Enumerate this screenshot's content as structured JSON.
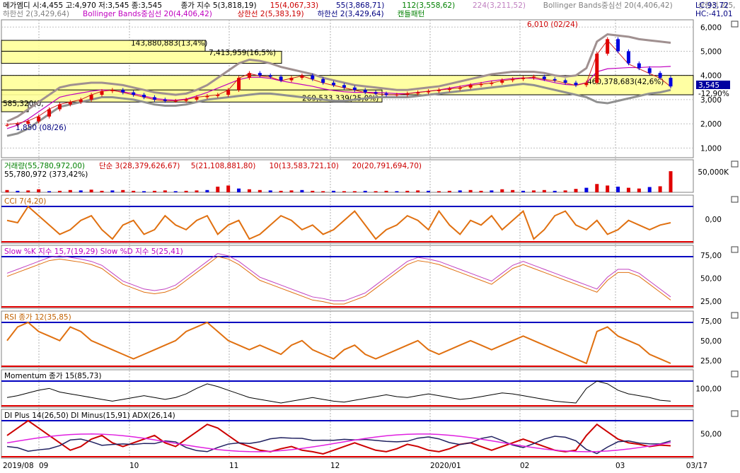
{
  "header": {
    "line1": [
      {
        "text": "메가엠디 시:4,455 고:4,970 저:3,545 종:3,545",
        "color": "#000000"
      },
      {
        "text": "종가 지수 5(3,818,19)",
        "color": "#000000"
      },
      {
        "text": "15(4,067,33)",
        "color": "#cc0000"
      },
      {
        "text": "55(3,868,71)",
        "color": "#000080"
      },
      {
        "text": "112(3,558,62)",
        "color": "#008000"
      },
      {
        "text": "224(3,211,52)",
        "color": "#c080c0"
      },
      {
        "text": "Bollinger Bands중심선 20(4,406,42)",
        "color": "#808080"
      },
      {
        "text": "상한선 2(5,",
        "color": "#808080"
      }
    ],
    "line2": [
      {
        "text": "하한선 2(3,429,64)",
        "color": "#808080"
      },
      {
        "text": "Bollinger Bands중심선 20(4,406,42)",
        "color": "#c000c0"
      },
      {
        "text": "상한선 2(5,383,19)",
        "color": "#cc0000"
      },
      {
        "text": "하한선 2(3,429,64)",
        "color": "#000080"
      },
      {
        "text": "캔들패턴",
        "color": "#008000"
      }
    ],
    "lc": "LC:93,72",
    "hc": "HC:-41,01",
    "icon": "blue-square-marker"
  },
  "price_panel": {
    "annotations": {
      "high_label": "6,010 (02/24)",
      "low_label": "1,850 (08/26)",
      "box_labels": [
        "143,880,883(13,4%)",
        "7,413,959(16,5%)",
        "269,533,339(25,0%)",
        "460,378,683(42,6%)",
        "585,320(0,"
      ],
      "current_price": "3,545",
      "change_pct": "-12,90%"
    },
    "chart_data": {
      "type": "line",
      "ylim": [
        600,
        6300
      ],
      "yticks": [
        "6,000",
        "5,000",
        "4,000",
        "3,000",
        "2,000",
        "1,000"
      ],
      "ytick_values": [
        6000,
        5000,
        4000,
        3000,
        2000,
        1000
      ],
      "close_series": [
        1950,
        2000,
        2100,
        2300,
        2600,
        2800,
        2900,
        3000,
        3200,
        3350,
        3400,
        3300,
        3200,
        3100,
        3000,
        2950,
        2950,
        3000,
        3100,
        3150,
        3200,
        3400,
        3900,
        4100,
        4000,
        3950,
        3800,
        3900,
        4000,
        3850,
        3700,
        3600,
        3500,
        3400,
        3300,
        3250,
        3200,
        3200,
        3250,
        3300,
        3350,
        3400,
        3450,
        3500,
        3600,
        3650,
        3700,
        3800,
        3850,
        3900,
        3950,
        3850,
        3800,
        3700,
        3600,
        3700,
        4900,
        5500,
        5000,
        4500,
        4300,
        4100,
        3900,
        3545
      ],
      "bollinger_upper": [
        2100,
        2300,
        2600,
        2900,
        3200,
        3500,
        3600,
        3650,
        3700,
        3700,
        3650,
        3600,
        3500,
        3400,
        3300,
        3250,
        3200,
        3250,
        3400,
        3600,
        3900,
        4200,
        4500,
        4650,
        4600,
        4500,
        4350,
        4250,
        4150,
        4050,
        3900,
        3800,
        3700,
        3600,
        3550,
        3500,
        3450,
        3400,
        3400,
        3450,
        3500,
        3550,
        3650,
        3750,
        3850,
        3950,
        4050,
        4100,
        4150,
        4150,
        4150,
        4100,
        4000,
        3950,
        4000,
        4300,
        5400,
        5700,
        5650,
        5600,
        5500,
        5450,
        5400,
        5350
      ],
      "bollinger_lower": [
        1500,
        1600,
        1800,
        2100,
        2400,
        2700,
        2800,
        2900,
        3000,
        3100,
        3100,
        3050,
        3000,
        2900,
        2800,
        2750,
        2750,
        2800,
        2900,
        3000,
        3050,
        3100,
        3150,
        3200,
        3250,
        3250,
        3200,
        3150,
        3100,
        3050,
        3000,
        2950,
        2950,
        3000,
        3050,
        3100,
        3100,
        3100,
        3100,
        3150,
        3200,
        3250,
        3300,
        3350,
        3400,
        3450,
        3500,
        3550,
        3600,
        3650,
        3600,
        3500,
        3400,
        3300,
        3200,
        3100,
        2900,
        2850,
        2950,
        3050,
        3150,
        3250,
        3300,
        3400
      ],
      "volume_label": "거래량(55,780,972,00)",
      "volume_ma": [
        "단순 3(28,379,626,67)",
        "5(21,108,881,80)",
        "10(13,583,721,10)",
        "20(20,791,694,70)"
      ],
      "volume_note": "55,780,972 (373,42%)",
      "volume_tick": "50,000K",
      "volume_values": [
        6,
        4,
        5,
        8,
        3,
        4,
        6,
        5,
        7,
        4,
        5,
        6,
        4,
        3,
        4,
        5,
        3,
        4,
        5,
        6,
        15,
        18,
        10,
        8,
        6,
        5,
        4,
        5,
        6,
        4,
        3,
        4,
        3,
        3,
        4,
        3,
        4,
        3,
        4,
        5,
        4,
        3,
        4,
        5,
        6,
        4,
        5,
        8,
        6,
        4,
        5,
        6,
        4,
        5,
        9,
        12,
        22,
        18,
        15,
        12,
        10,
        14,
        16,
        56
      ]
    }
  },
  "indicators": [
    {
      "label": "CCI 7(4,20)",
      "tick": "0,00",
      "values": [
        10,
        5,
        40,
        20,
        0,
        -20,
        -10,
        10,
        20,
        -10,
        -30,
        0,
        10,
        -20,
        -10,
        20,
        0,
        -10,
        10,
        20,
        -20,
        0,
        10,
        -30,
        -20,
        0,
        20,
        10,
        -10,
        0,
        -20,
        -10,
        10,
        30,
        0,
        -30,
        -10,
        0,
        20,
        10,
        -10,
        30,
        0,
        -20,
        10,
        0,
        20,
        -10,
        10,
        30,
        -30,
        -10,
        20,
        30,
        0,
        -10,
        10,
        -20,
        -10,
        10,
        0,
        -10,
        0,
        5
      ]
    },
    {
      "label": "Slow %K 지수 15,7(19,29)  Slow %D 지수 5(25,41)",
      "ticks": [
        "75,00",
        "50,00",
        "25,00"
      ],
      "values": [
        50,
        55,
        60,
        65,
        70,
        72,
        70,
        68,
        65,
        60,
        50,
        40,
        35,
        30,
        28,
        30,
        35,
        45,
        55,
        65,
        75,
        72,
        65,
        55,
        45,
        40,
        35,
        30,
        25,
        20,
        18,
        15,
        15,
        20,
        25,
        35,
        45,
        55,
        65,
        70,
        68,
        65,
        60,
        55,
        50,
        45,
        40,
        50,
        60,
        65,
        60,
        55,
        50,
        45,
        40,
        35,
        30,
        45,
        55,
        55,
        50,
        40,
        30,
        20
      ]
    },
    {
      "label": "RSI 종가 12(35,85)",
      "ticks": [
        "75,00",
        "50,00",
        "25,00"
      ],
      "values": [
        60,
        75,
        80,
        70,
        65,
        60,
        75,
        70,
        60,
        55,
        50,
        45,
        40,
        45,
        50,
        55,
        60,
        70,
        75,
        80,
        70,
        60,
        55,
        50,
        55,
        50,
        45,
        55,
        60,
        50,
        45,
        40,
        50,
        55,
        45,
        40,
        45,
        50,
        55,
        60,
        50,
        45,
        50,
        55,
        60,
        55,
        50,
        55,
        60,
        65,
        60,
        55,
        50,
        45,
        40,
        35,
        70,
        75,
        65,
        60,
        55,
        45,
        40,
        35
      ]
    },
    {
      "label": "Momentum 종가 15(85,73)",
      "tick": "100,00",
      "values": [
        100,
        102,
        105,
        108,
        110,
        106,
        104,
        102,
        100,
        98,
        96,
        98,
        100,
        102,
        100,
        98,
        100,
        104,
        110,
        115,
        112,
        108,
        104,
        100,
        98,
        96,
        94,
        96,
        98,
        100,
        98,
        96,
        95,
        97,
        99,
        101,
        103,
        101,
        100,
        102,
        104,
        102,
        100,
        98,
        99,
        101,
        103,
        105,
        104,
        102,
        100,
        98,
        96,
        95,
        94,
        110,
        118,
        115,
        108,
        104,
        102,
        100,
        97,
        96
      ]
    },
    {
      "label": "DI Plus 14(26,50)  DI Minus(15,91)  ADX(26,14)",
      "tick": "50,00",
      "values": [
        40,
        50,
        60,
        50,
        40,
        30,
        20,
        25,
        35,
        40,
        30,
        25,
        30,
        35,
        40,
        30,
        25,
        35,
        45,
        55,
        50,
        40,
        30,
        25,
        20,
        18,
        22,
        25,
        20,
        18,
        15,
        20,
        25,
        30,
        25,
        20,
        18,
        22,
        28,
        25,
        20,
        18,
        22,
        28,
        30,
        25,
        20,
        25,
        30,
        35,
        30,
        25,
        20,
        18,
        20,
        40,
        55,
        45,
        35,
        30,
        28,
        25,
        27,
        26
      ]
    }
  ],
  "x_axis": {
    "labels": [
      "2019/08",
      "09",
      "10",
      "11",
      "12",
      "2020/01",
      "02",
      "03",
      "03/17"
    ]
  },
  "colors": {
    "up": "#e00000",
    "down": "#0000e0",
    "bb": "#a0a0a0",
    "sma": "#e07010",
    "slow_k": "#c06000",
    "slow_d": "#c040c0"
  }
}
